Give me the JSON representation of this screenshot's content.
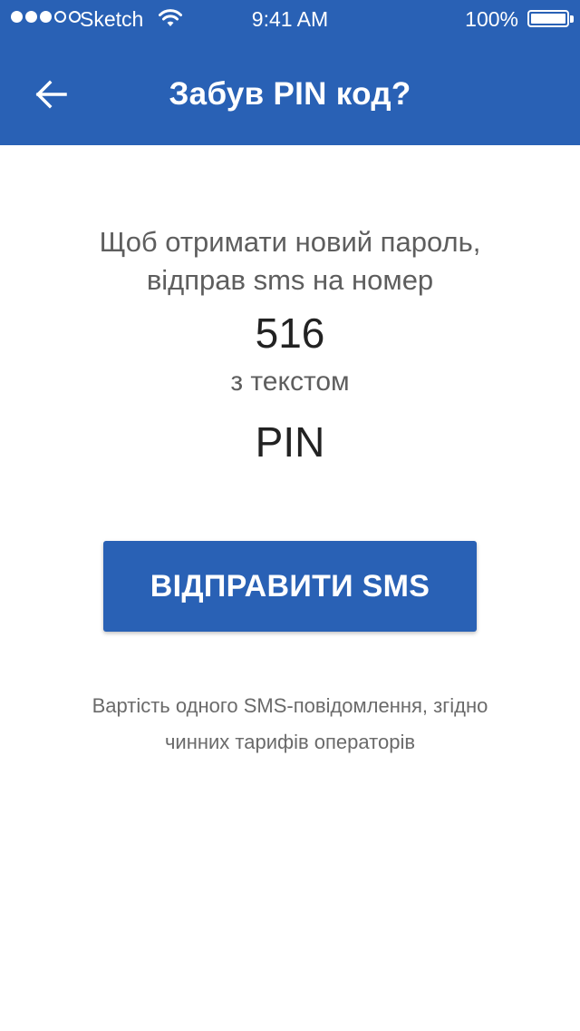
{
  "status_bar": {
    "carrier": "Sketch",
    "time": "9:41 AM",
    "battery": "100%",
    "signal_filled": 3,
    "signal_total": 5
  },
  "header": {
    "title": "Забув PIN код?",
    "back_icon": "arrow-left-icon",
    "background_color": "#2961b5"
  },
  "main": {
    "instruction_line1": "Щоб отримати новий пароль,",
    "instruction_line2": "відправ sms на номер",
    "number": "516",
    "with_text_label": "з текстом",
    "sms_text": "PIN",
    "send_button_label": "ВІДПРАВИТИ SMS",
    "cost_note_line1": "Вартість одного SMS-повідомлення, згідно",
    "cost_note_line2": "чинних тарифів операторів"
  }
}
